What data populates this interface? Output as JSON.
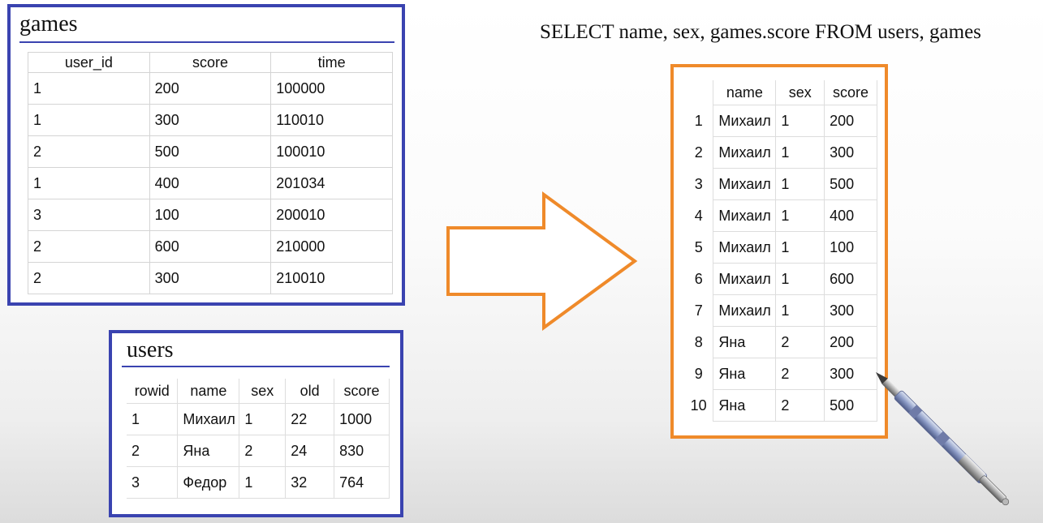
{
  "query": "SELECT name, sex, games.score FROM users, games",
  "games": {
    "title": "games",
    "columns": [
      "user_id",
      "score",
      "time"
    ],
    "rows": [
      [
        "1",
        "200",
        "100000"
      ],
      [
        "1",
        "300",
        "110010"
      ],
      [
        "2",
        "500",
        "100010"
      ],
      [
        "1",
        "400",
        "201034"
      ],
      [
        "3",
        "100",
        "200010"
      ],
      [
        "2",
        "600",
        "210000"
      ],
      [
        "2",
        "300",
        "210010"
      ]
    ]
  },
  "users": {
    "title": "users",
    "columns": [
      "rowid",
      "name",
      "sex",
      "old",
      "score"
    ],
    "rows": [
      [
        "1",
        "Михаил",
        "1",
        "22",
        "1000"
      ],
      [
        "2",
        "Яна",
        "2",
        "24",
        "830"
      ],
      [
        "3",
        "Федор",
        "1",
        "32",
        "764"
      ]
    ]
  },
  "result": {
    "columns": [
      "name",
      "sex",
      "score"
    ],
    "rows": [
      {
        "index": "1",
        "cells": [
          "Михаил",
          "1",
          "200"
        ]
      },
      {
        "index": "2",
        "cells": [
          "Михаил",
          "1",
          "300"
        ]
      },
      {
        "index": "3",
        "cells": [
          "Михаил",
          "1",
          "500"
        ]
      },
      {
        "index": "4",
        "cells": [
          "Михаил",
          "1",
          "400"
        ]
      },
      {
        "index": "5",
        "cells": [
          "Михаил",
          "1",
          "100"
        ]
      },
      {
        "index": "6",
        "cells": [
          "Михаил",
          "1",
          "600"
        ]
      },
      {
        "index": "7",
        "cells": [
          "Михаил",
          "1",
          "300"
        ]
      },
      {
        "index": "8",
        "cells": [
          "Яна",
          "2",
          "200"
        ]
      },
      {
        "index": "9",
        "cells": [
          "Яна",
          "2",
          "300"
        ]
      },
      {
        "index": "10",
        "cells": [
          "Яна",
          "2",
          "500"
        ]
      }
    ]
  },
  "colors": {
    "table_frame": "#3a43b0",
    "result_frame": "#ef8a2a",
    "arrow": "#ef8a2a"
  },
  "icons": [
    "right-arrow-icon",
    "pen-icon"
  ]
}
